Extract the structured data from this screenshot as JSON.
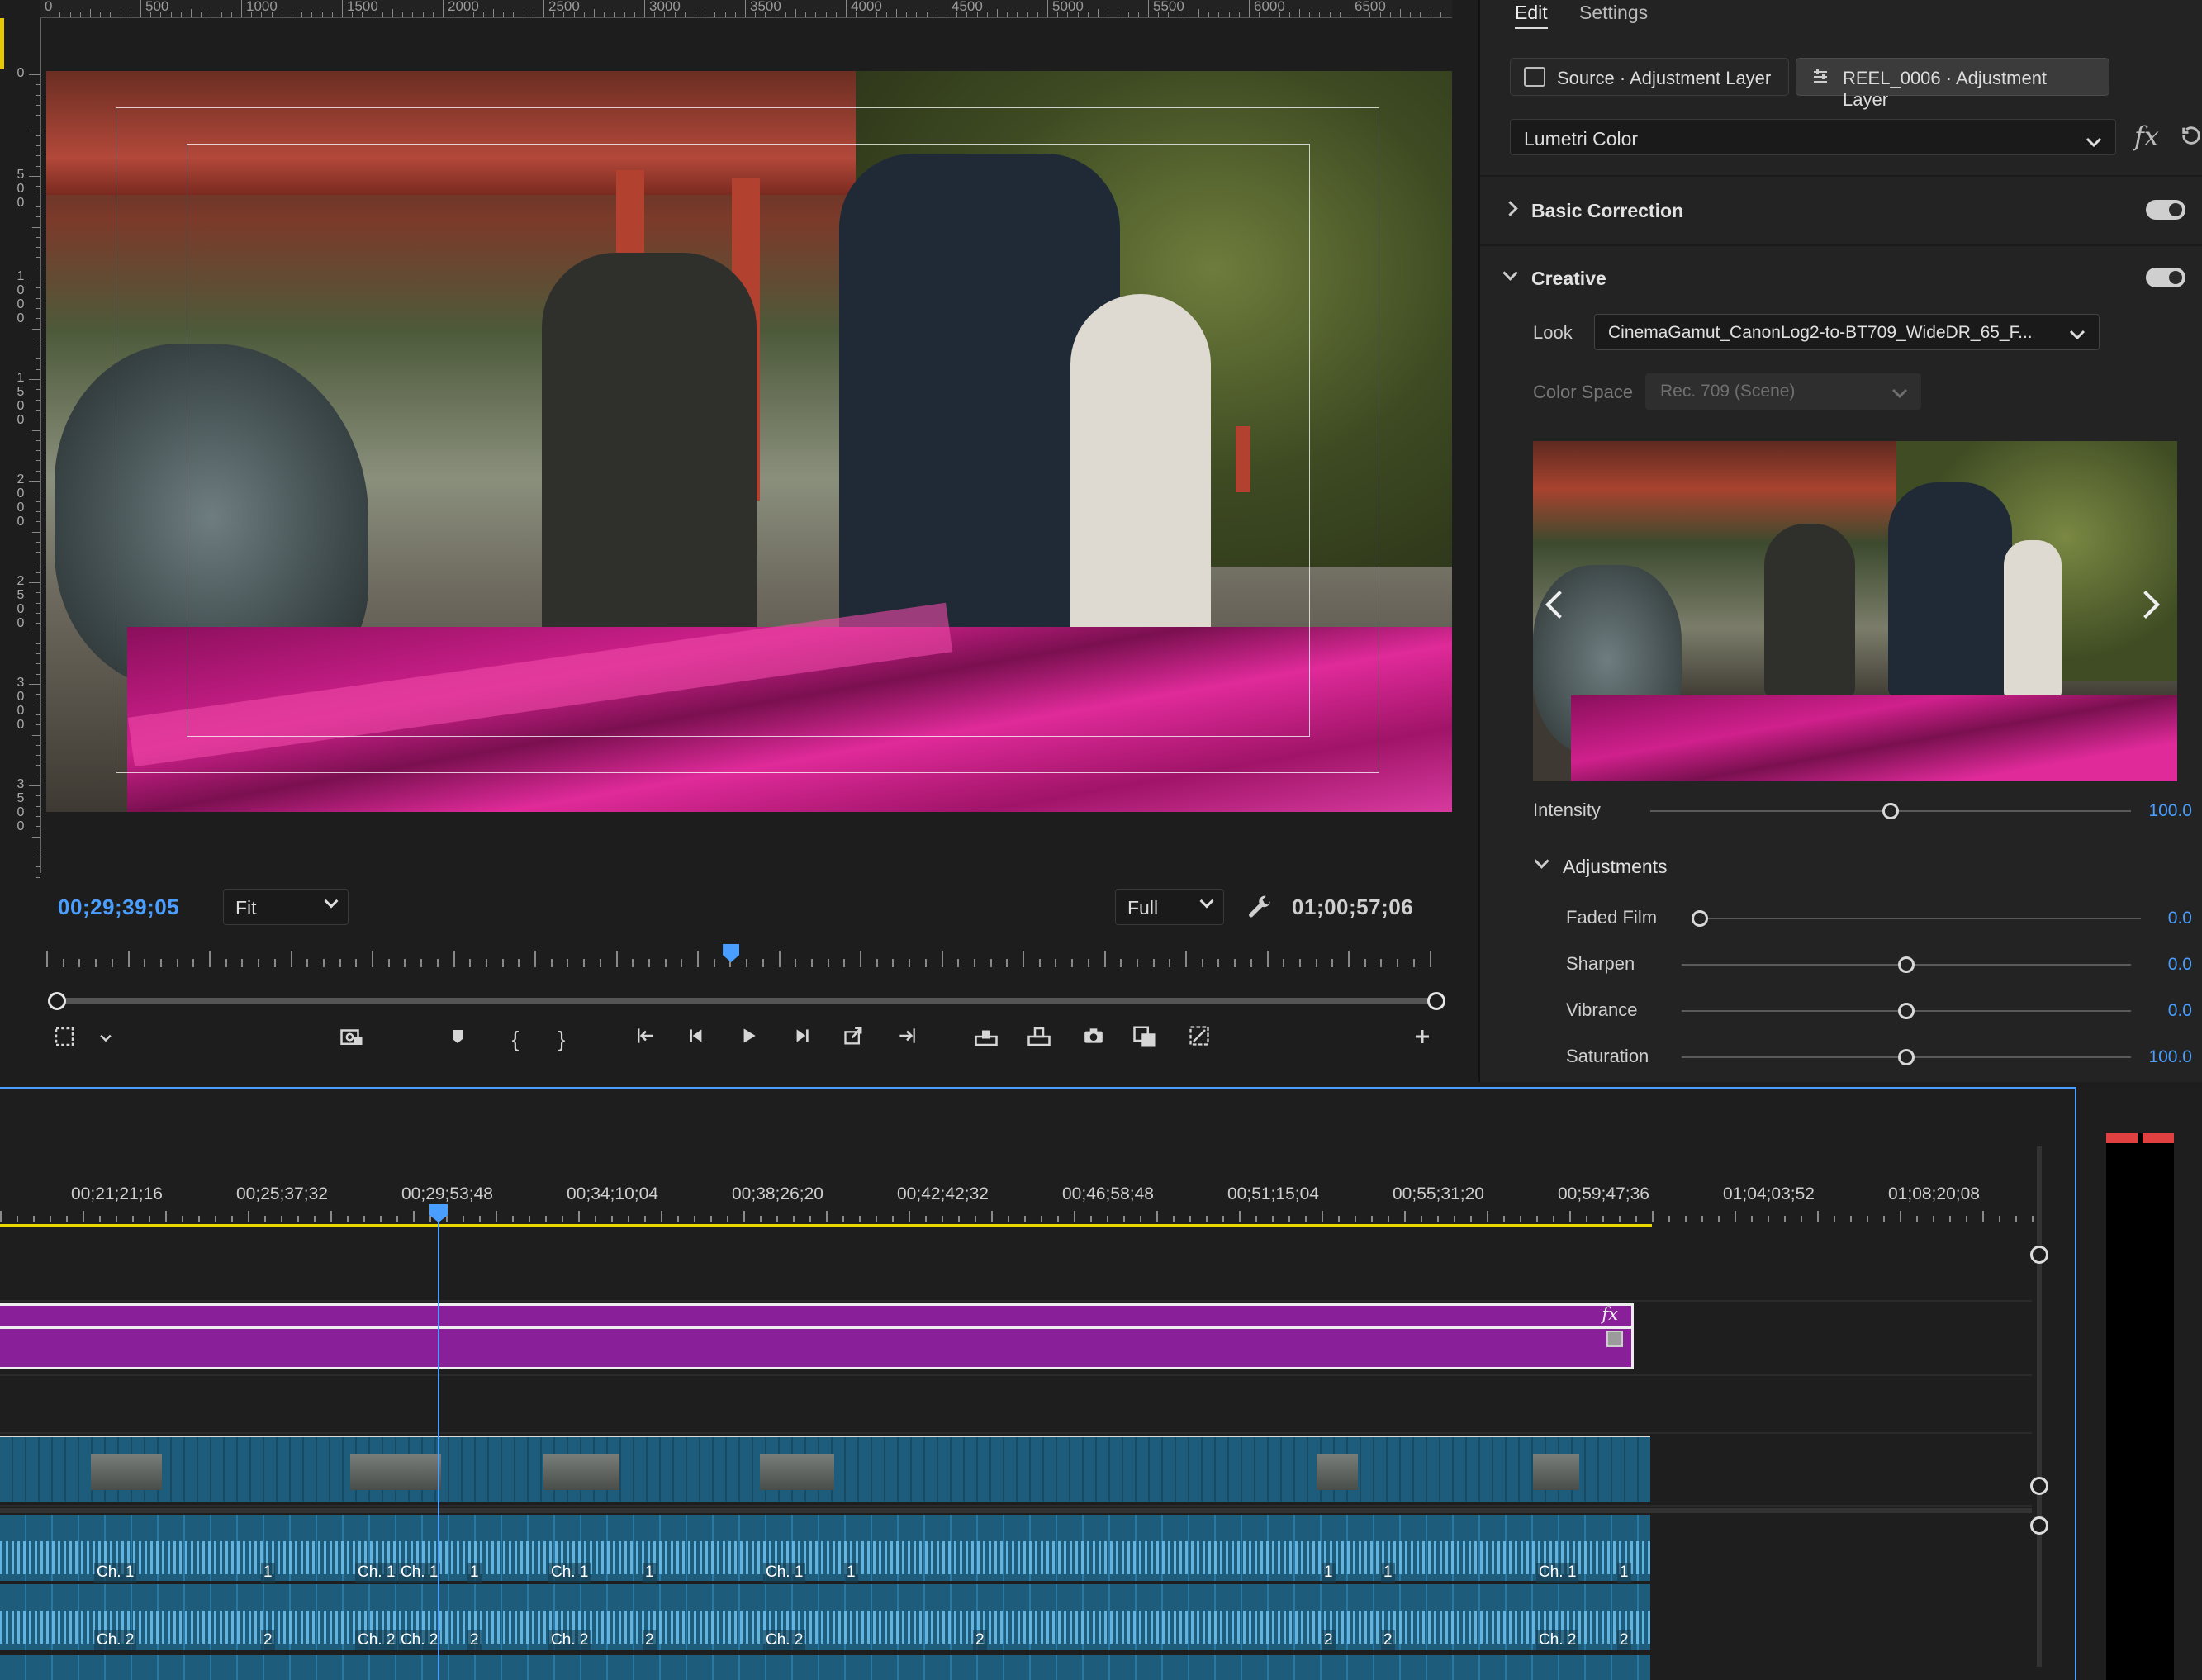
{
  "monitor": {
    "ruler_top_labels": [
      "0",
      "500",
      "1000",
      "1500",
      "2000",
      "2500",
      "3000",
      "3500",
      "4000",
      "4500",
      "5000",
      "5500",
      "6000",
      "6500"
    ],
    "ruler_left_labels": [
      "0",
      "500",
      "1000",
      "1500",
      "2000",
      "2500",
      "3000",
      "3500"
    ],
    "timecode_current": "00;29;39;05",
    "zoom_select": "Fit",
    "quality_select": "Full",
    "timecode_duration": "01;00;57;06",
    "playhead_progress": 0.49
  },
  "panel": {
    "tabs": [
      "Edit",
      "Settings"
    ],
    "source_chip": "Source · Adjustment Layer",
    "target_chip": "REEL_0006 · Adjustment Layer",
    "effect_select": "Lumetri Color",
    "fx_label": "fx",
    "sections": {
      "basic_correction": "Basic Correction",
      "creative": "Creative",
      "adjustments": "Adjustments"
    },
    "look_label": "Look",
    "look_value": "CinemaGamut_CanonLog2-to-BT709_WideDR_65_F...",
    "color_space_label": "Color Space",
    "color_space_value": "Rec. 709 (Scene)",
    "intensity": {
      "label": "Intensity",
      "value": "100.0",
      "level": 0.5
    },
    "sliders": [
      {
        "label": "Faded Film",
        "value": "0.0",
        "level": 0.0
      },
      {
        "label": "Sharpen",
        "value": "0.0",
        "level": 0.5
      },
      {
        "label": "Vibrance",
        "value": "0.0",
        "level": 0.5
      },
      {
        "label": "Saturation",
        "value": "100.0",
        "level": 0.5
      }
    ]
  },
  "timeline": {
    "ruler_labels": [
      "00;21;21;16",
      "00;25;37;32",
      "00;29;53;48",
      "00;34;10;04",
      "00;38;26;20",
      "00;42;42;32",
      "00;46;58;48",
      "00;51;15;04",
      "00;55;31;20",
      "00;59;47;36",
      "01;04;03;52",
      "01;08;20;08"
    ],
    "adjustment_fx": "fx",
    "audio_channels": [
      "Ch. 1",
      "Ch. 2"
    ],
    "audio_markers": [
      "1",
      "2"
    ]
  },
  "colors": {
    "accent": "#4a9eff",
    "adjustment_clip": "#8a1f9a",
    "video_clip": "#1e5c7c",
    "in_out_bar": "#e8d800",
    "peak": "#e04040"
  }
}
